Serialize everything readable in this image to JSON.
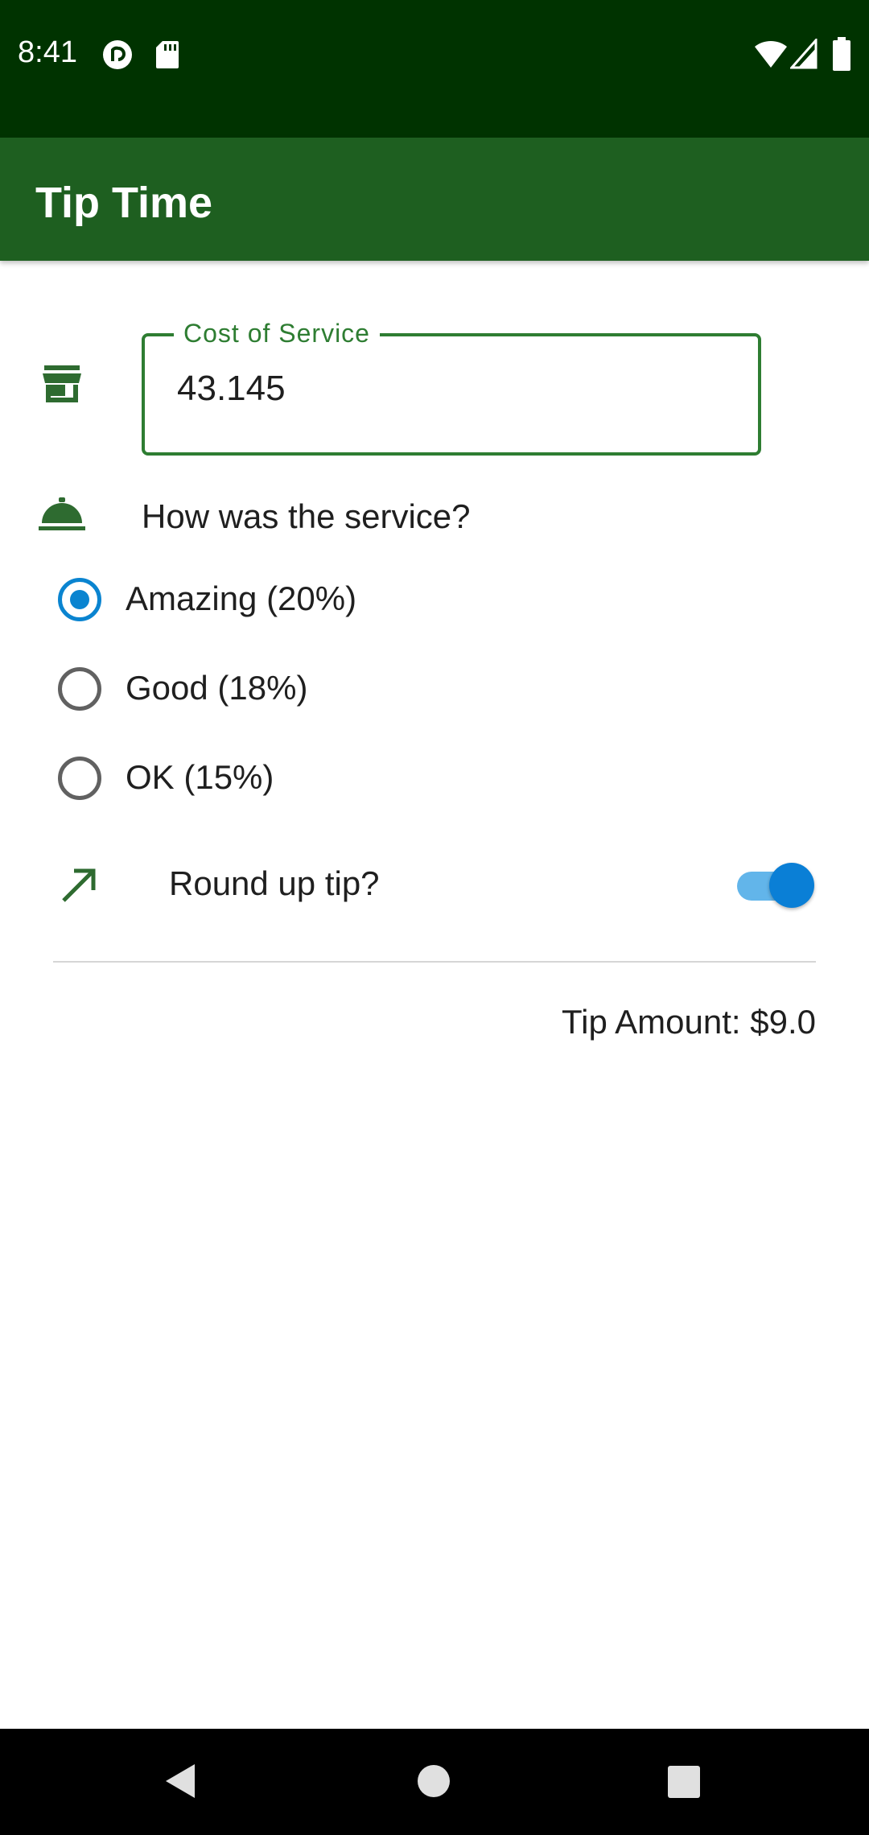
{
  "status_bar": {
    "time": "8:41",
    "left_icons": [
      "pocket-casts-icon",
      "sd-card-icon"
    ],
    "right_icons": [
      "wifi-icon",
      "cell-signal-icon",
      "battery-icon"
    ]
  },
  "app_bar": {
    "title": "Tip Time"
  },
  "cost_field": {
    "label": "Cost of Service",
    "value": "43.145",
    "icon": "storefront-icon"
  },
  "service_question": {
    "icon": "room-service-icon",
    "text": "How was the service?"
  },
  "tip_options": [
    {
      "label": "Amazing (20%)",
      "checked": true
    },
    {
      "label": "Good (18%)",
      "checked": false
    },
    {
      "label": "OK (15%)",
      "checked": false
    }
  ],
  "round_up": {
    "icon": "trending-up-arrow-icon",
    "label": "Round up tip?",
    "enabled": true
  },
  "tip_amount": "Tip Amount: $9.0",
  "nav_bar": {
    "buttons": [
      "back-icon",
      "home-icon",
      "recents-icon"
    ]
  },
  "colors": {
    "status_bar": "#003300",
    "app_bar": "#1e5f20",
    "accent_green": "#2e7d32",
    "accent_blue": "#0a84d0"
  }
}
